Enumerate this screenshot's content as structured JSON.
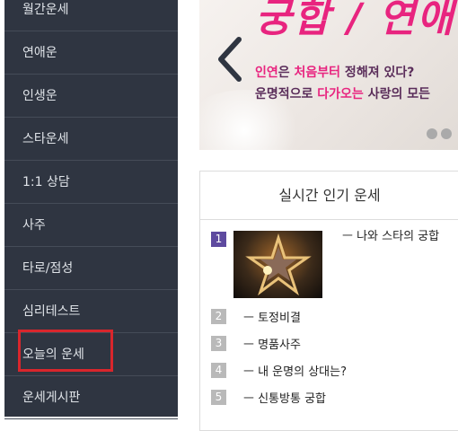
{
  "sidebar": {
    "items": [
      {
        "label": "월간운세"
      },
      {
        "label": "연애운"
      },
      {
        "label": "인생운"
      },
      {
        "label": "스타운세"
      },
      {
        "label": "1:1 상담"
      },
      {
        "label": "사주"
      },
      {
        "label": "타로/점성"
      },
      {
        "label": "심리테스트"
      },
      {
        "label": "오늘의 운세"
      },
      {
        "label": "운세게시판"
      }
    ],
    "highlight_color": "#d9262c"
  },
  "banner": {
    "title": "궁합 / 연애",
    "line1_hl1": "인연",
    "line1_mid": "은 ",
    "line1_hl2": "처음부터",
    "line1_rest": " 정해져 있다?",
    "line2_a": "운명적으로 ",
    "line2_hl": "다가오는",
    "line2_rest": " 사랑의 모든",
    "prev_icon": "chevron-left-icon",
    "accent": "#e8247f"
  },
  "ranking": {
    "title": "실시간 인기 운세",
    "items": [
      {
        "num": "1",
        "label": "ㅡ 나와 스타의 궁합"
      },
      {
        "num": "2",
        "label": "ㅡ 토정비결"
      },
      {
        "num": "3",
        "label": "ㅡ 명품사주"
      },
      {
        "num": "4",
        "label": "ㅡ 내 운명의 상대는?"
      },
      {
        "num": "5",
        "label": "ㅡ 신통방통 궁합"
      }
    ]
  }
}
